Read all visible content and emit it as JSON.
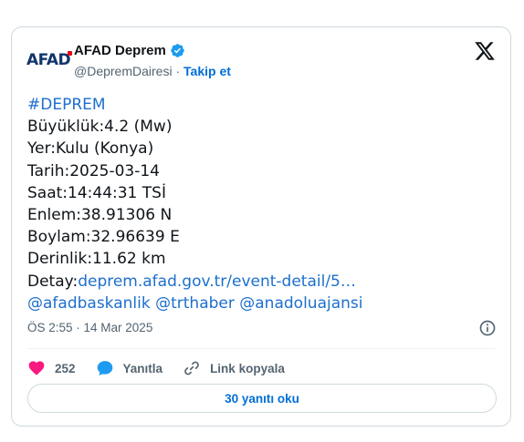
{
  "author": {
    "name": "AFAD Deprem",
    "handle": "@DepremDairesi",
    "separator": "·",
    "follow_label": "Takip et",
    "logo_text": "AFAD",
    "verified": true
  },
  "tweet": {
    "lines": [
      {
        "text": "#DEPREM",
        "kind": "hashtag"
      },
      {
        "text": "Büyüklük:4.2 (Mw)"
      },
      {
        "text": "Yer:Kulu (Konya)"
      },
      {
        "text": "Tarih:2025-03-14"
      },
      {
        "text": "Saat:14:44:31 TSİ"
      },
      {
        "text": "Enlem:38.91306 N"
      },
      {
        "text": "Boylam:32.96639 E"
      },
      {
        "text": "Derinlik:11.62 km"
      }
    ],
    "detail_prefix": "Detay:",
    "detail_link": "deprem.afad.gov.tr/event-detail/5…",
    "mentions": "@afadbaskanlik @trthaber @anadoluajansi",
    "timestamp": "ÖS 2:55 · 14 Mar 2025"
  },
  "actions": {
    "like_count": "252",
    "reply_label": "Yanıtla",
    "copy_link_label": "Link kopyala"
  },
  "replies_button": "30 yanıtı oku",
  "icons": [
    "afad-logo",
    "verified-badge-icon",
    "x-logo-icon",
    "info-icon",
    "heart-icon",
    "reply-icon",
    "link-icon"
  ],
  "colors": {
    "link": "#1d6fce",
    "button_text": "#006fd6",
    "heart": "#f91880",
    "reply_bubble": "#1d9bf0",
    "afad_blue": "#12356b",
    "afad_red": "#e30613",
    "verified": "#1d9bf0"
  }
}
